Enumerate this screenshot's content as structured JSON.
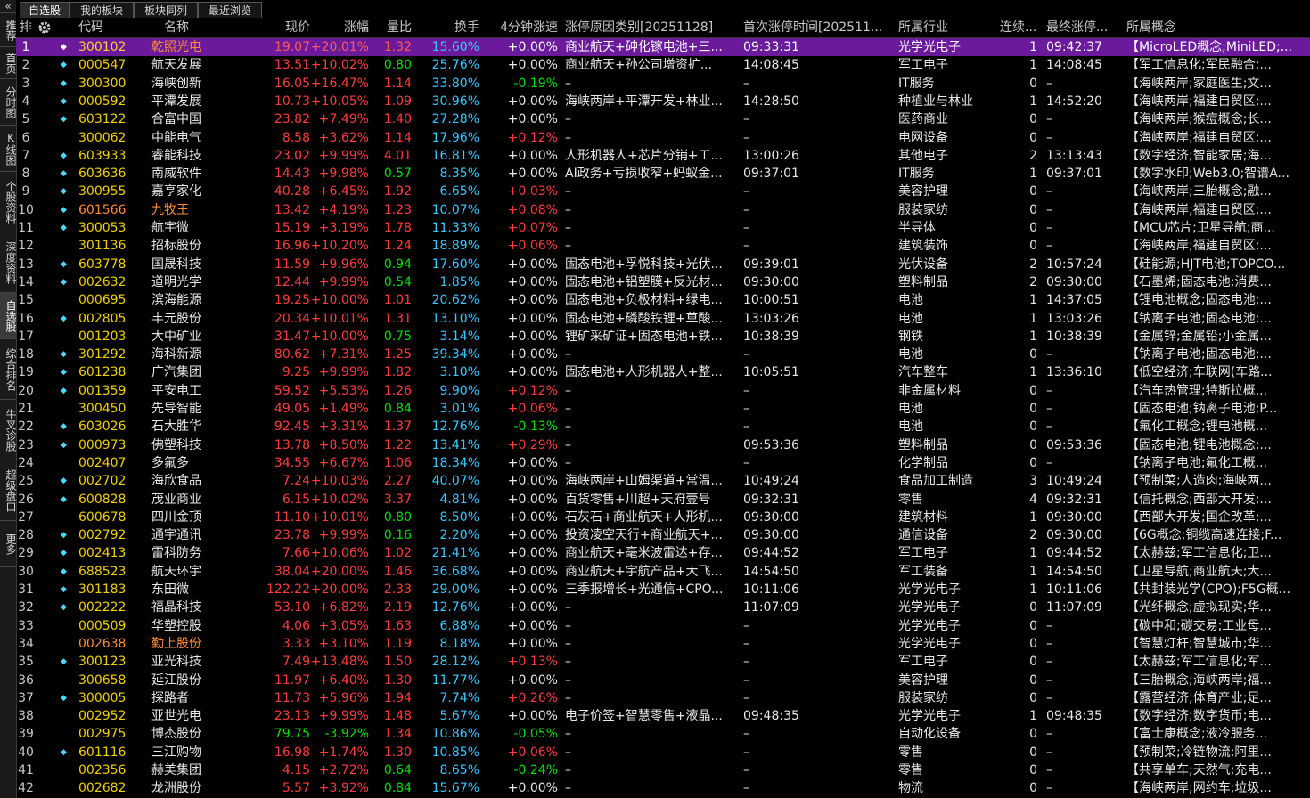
{
  "sidebar": {
    "collapse": "«",
    "items": [
      "推荐",
      "首页",
      "分时图",
      "K线图",
      "个股资料",
      "深度资料",
      "自选股",
      "综合排名",
      "牛叉诊股",
      "超级盘口",
      "更多"
    ]
  },
  "tabs": [
    "自选股",
    "我的板块",
    "板块同列",
    "最近浏览"
  ],
  "header": {
    "rank": "排",
    "settings_icon": "gear-icon",
    "code": "代码",
    "name": "名称",
    "price": "现价",
    "change": "涨幅",
    "vol_ratio": "量比",
    "turnover": "换手",
    "speed": "4分钟涨速",
    "reason": "涨停原因类别[20251128]",
    "first_time": "首次涨停时间[202511...",
    "industry": "所属行业",
    "streak": "连续...",
    "last_time": "最终涨停...",
    "concept": "所属概念"
  },
  "rows": [
    {
      "n": "1",
      "dot": true,
      "code": "300102",
      "name": "乾照光电",
      "price": "19.07",
      "chg": "+20.01%",
      "vr": "1.32",
      "turn": "15.60%",
      "speed": "+0.00%",
      "reason": "商业航天+砷化镓电池+三...",
      "first": "09:33:31",
      "ind": "光学光电子",
      "streak": "1",
      "last": "09:42:37",
      "concept": "【MicroLED概念;MiniLED;..."
    },
    {
      "n": "2",
      "dot": true,
      "code": "000547",
      "name": "航天发展",
      "price": "13.51",
      "chg": "+10.02%",
      "vr": "0.80",
      "turn": "25.76%",
      "speed": "+0.00%",
      "reason": "商业航天+孙公司增资扩...",
      "first": "14:08:45",
      "ind": "军工电子",
      "streak": "1",
      "last": "14:08:45",
      "concept": "【军工信息化;军民融合;..."
    },
    {
      "n": "3",
      "dot": true,
      "code": "300300",
      "name": "海峡创新",
      "price": "16.05",
      "chg": "+16.47%",
      "vr": "1.14",
      "turn": "33.80%",
      "speed": "-0.19%",
      "reason": "–",
      "first": "–",
      "ind": "IT服务",
      "streak": "0",
      "last": "–",
      "concept": "【海峡两岸;家庭医生;文..."
    },
    {
      "n": "4",
      "dot": true,
      "code": "000592",
      "name": "平潭发展",
      "price": "10.73",
      "chg": "+10.05%",
      "vr": "1.09",
      "turn": "30.96%",
      "speed": "+0.00%",
      "reason": "海峡两岸+平潭开发+林业...",
      "first": "14:28:50",
      "ind": "种植业与林业",
      "streak": "1",
      "last": "14:52:20",
      "concept": "【海峡两岸;福建自贸区;..."
    },
    {
      "n": "5",
      "dot": true,
      "code": "603122",
      "name": "合富中国",
      "price": "23.82",
      "chg": "+7.49%",
      "vr": "1.40",
      "turn": "27.28%",
      "speed": "+0.00%",
      "reason": "–",
      "first": "–",
      "ind": "医药商业",
      "streak": "0",
      "last": "–",
      "concept": "【海峡两岸;猴痘概念;长..."
    },
    {
      "n": "6",
      "dot": false,
      "code": "300062",
      "name": "中能电气",
      "price": "8.58",
      "chg": "+3.62%",
      "vr": "1.14",
      "turn": "17.96%",
      "speed": "+0.12%",
      "reason": "–",
      "first": "–",
      "ind": "电网设备",
      "streak": "0",
      "last": "–",
      "concept": "【海峡两岸;福建自贸区;..."
    },
    {
      "n": "7",
      "dot": true,
      "code": "603933",
      "name": "睿能科技",
      "price": "23.02",
      "chg": "+9.99%",
      "vr": "4.01",
      "turn": "16.81%",
      "speed": "+0.00%",
      "reason": "人形机器人+芯片分销+工...",
      "first": "13:00:26",
      "ind": "其他电子",
      "streak": "2",
      "last": "13:13:43",
      "concept": "【数字经济;智能家居;海..."
    },
    {
      "n": "8",
      "dot": true,
      "code": "603636",
      "name": "南威软件",
      "price": "14.43",
      "chg": "+9.98%",
      "vr": "0.57",
      "turn": "8.35%",
      "speed": "+0.00%",
      "reason": "AI政务+亏损收窄+蚂蚁金...",
      "first": "09:37:01",
      "ind": "IT服务",
      "streak": "1",
      "last": "09:37:01",
      "concept": "【数字水印;Web3.0;智谱A..."
    },
    {
      "n": "9",
      "dot": true,
      "code": "300955",
      "name": "嘉亨家化",
      "price": "40.28",
      "chg": "+6.45%",
      "vr": "1.92",
      "turn": "6.65%",
      "speed": "+0.03%",
      "reason": "–",
      "first": "–",
      "ind": "美容护理",
      "streak": "0",
      "last": "–",
      "concept": "【海峡两岸;三胎概念;融..."
    },
    {
      "n": "10",
      "dot": true,
      "code": "601566",
      "name": "九牧王",
      "price": "13.42",
      "chg": "+4.19%",
      "vr": "1.23",
      "turn": "10.07%",
      "speed": "+0.08%",
      "reason": "–",
      "first": "–",
      "ind": "服装家纺",
      "streak": "0",
      "last": "–",
      "concept": "【海峡两岸;福建自贸区;...",
      "orange": true
    },
    {
      "n": "11",
      "dot": true,
      "code": "300053",
      "name": "航宇微",
      "price": "15.19",
      "chg": "+3.19%",
      "vr": "1.78",
      "turn": "11.33%",
      "speed": "+0.07%",
      "reason": "–",
      "first": "–",
      "ind": "半导体",
      "streak": "0",
      "last": "–",
      "concept": "【MCU芯片;卫星导航;商..."
    },
    {
      "n": "12",
      "dot": false,
      "code": "301136",
      "name": "招标股份",
      "price": "16.96",
      "chg": "+10.20%",
      "vr": "1.24",
      "turn": "18.89%",
      "speed": "+0.06%",
      "reason": "–",
      "first": "–",
      "ind": "建筑装饰",
      "streak": "0",
      "last": "–",
      "concept": "【海峡两岸;福建自贸区;..."
    },
    {
      "n": "13",
      "dot": true,
      "code": "603778",
      "name": "国晟科技",
      "price": "11.59",
      "chg": "+9.96%",
      "vr": "0.94",
      "turn": "17.60%",
      "speed": "+0.00%",
      "reason": "固态电池+孚悦科技+光伏...",
      "first": "09:39:01",
      "ind": "光伏设备",
      "streak": "2",
      "last": "10:57:24",
      "concept": "【硅能源;HJT电池;TOPCO..."
    },
    {
      "n": "14",
      "dot": true,
      "code": "002632",
      "name": "道明光学",
      "price": "12.44",
      "chg": "+9.99%",
      "vr": "0.54",
      "turn": "1.85%",
      "speed": "+0.00%",
      "reason": "固态电池+铝塑膜+反光材...",
      "first": "09:30:00",
      "ind": "塑料制品",
      "streak": "2",
      "last": "09:30:00",
      "concept": "【石墨烯;固态电池;消费..."
    },
    {
      "n": "15",
      "dot": false,
      "code": "000695",
      "name": "滨海能源",
      "price": "19.25",
      "chg": "+10.00%",
      "vr": "1.01",
      "turn": "20.62%",
      "speed": "+0.00%",
      "reason": "固态电池+负极材料+绿电...",
      "first": "10:00:51",
      "ind": "电池",
      "streak": "1",
      "last": "14:37:05",
      "concept": "【锂电池概念;固态电池;..."
    },
    {
      "n": "16",
      "dot": true,
      "code": "002805",
      "name": "丰元股份",
      "price": "20.34",
      "chg": "+10.01%",
      "vr": "1.31",
      "turn": "13.10%",
      "speed": "+0.00%",
      "reason": "固态电池+磷酸铁锂+草酸...",
      "first": "13:03:26",
      "ind": "电池",
      "streak": "1",
      "last": "13:03:26",
      "concept": "【钠离子电池;固态电池;..."
    },
    {
      "n": "17",
      "dot": false,
      "code": "001203",
      "name": "大中矿业",
      "price": "31.47",
      "chg": "+10.00%",
      "vr": "0.75",
      "turn": "3.14%",
      "speed": "+0.00%",
      "reason": "锂矿采矿证+固态电池+铁...",
      "first": "10:38:39",
      "ind": "钢铁",
      "streak": "1",
      "last": "10:38:39",
      "concept": "【金属锌;金属铅;小金属..."
    },
    {
      "n": "18",
      "dot": true,
      "code": "301292",
      "name": "海科新源",
      "price": "80.62",
      "chg": "+7.31%",
      "vr": "1.25",
      "turn": "39.34%",
      "speed": "+0.00%",
      "reason": "–",
      "first": "–",
      "ind": "电池",
      "streak": "0",
      "last": "–",
      "concept": "【钠离子电池;固态电池;..."
    },
    {
      "n": "19",
      "dot": true,
      "code": "601238",
      "name": "广汽集团",
      "price": "9.25",
      "chg": "+9.99%",
      "vr": "1.82",
      "turn": "3.10%",
      "speed": "+0.00%",
      "reason": "固态电池+人形机器人+整...",
      "first": "10:05:51",
      "ind": "汽车整车",
      "streak": "1",
      "last": "13:36:10",
      "concept": "【低空经济;车联网(车路..."
    },
    {
      "n": "20",
      "dot": true,
      "code": "001359",
      "name": "平安电工",
      "price": "59.52",
      "chg": "+5.53%",
      "vr": "1.26",
      "turn": "9.90%",
      "speed": "+0.12%",
      "reason": "–",
      "first": "–",
      "ind": "非金属材料",
      "streak": "0",
      "last": "–",
      "concept": "【汽车热管理;特斯拉概..."
    },
    {
      "n": "21",
      "dot": false,
      "code": "300450",
      "name": "先导智能",
      "price": "49.05",
      "chg": "+1.49%",
      "vr": "0.84",
      "turn": "3.01%",
      "speed": "+0.06%",
      "reason": "–",
      "first": "–",
      "ind": "电池",
      "streak": "0",
      "last": "–",
      "concept": "【固态电池;钠离子电池;P..."
    },
    {
      "n": "22",
      "dot": true,
      "code": "603026",
      "name": "石大胜华",
      "price": "92.45",
      "chg": "+3.31%",
      "vr": "1.37",
      "turn": "12.76%",
      "speed": "-0.13%",
      "reason": "–",
      "first": "–",
      "ind": "电池",
      "streak": "0",
      "last": "–",
      "concept": "【氟化工概念;锂电池概..."
    },
    {
      "n": "23",
      "dot": true,
      "code": "000973",
      "name": "佛塑科技",
      "price": "13.78",
      "chg": "+8.50%",
      "vr": "1.22",
      "turn": "13.41%",
      "speed": "+0.29%",
      "reason": "–",
      "first": "09:53:36",
      "ind": "塑料制品",
      "streak": "0",
      "last": "09:53:36",
      "concept": "【固态电池;锂电池概念;..."
    },
    {
      "n": "24",
      "dot": false,
      "code": "002407",
      "name": "多氟多",
      "price": "34.55",
      "chg": "+6.67%",
      "vr": "1.06",
      "turn": "18.34%",
      "speed": "+0.00%",
      "reason": "–",
      "first": "–",
      "ind": "化学制品",
      "streak": "0",
      "last": "–",
      "concept": "【钠离子电池;氟化工概..."
    },
    {
      "n": "25",
      "dot": true,
      "code": "002702",
      "name": "海欣食品",
      "price": "7.24",
      "chg": "+10.03%",
      "vr": "2.27",
      "turn": "40.07%",
      "speed": "+0.00%",
      "reason": "海峡两岸+山姆渠道+常温...",
      "first": "10:49:24",
      "ind": "食品加工制造",
      "streak": "3",
      "last": "10:49:24",
      "concept": "【预制菜;人造肉;海峡两..."
    },
    {
      "n": "26",
      "dot": true,
      "code": "600828",
      "name": "茂业商业",
      "price": "6.15",
      "chg": "+10.02%",
      "vr": "3.37",
      "turn": "4.81%",
      "speed": "+0.00%",
      "reason": "百货零售+川超+天府壹号",
      "first": "09:32:31",
      "ind": "零售",
      "streak": "4",
      "last": "09:32:31",
      "concept": "【信托概念;西部大开发;..."
    },
    {
      "n": "27",
      "dot": false,
      "code": "600678",
      "name": "四川金顶",
      "price": "11.10",
      "chg": "+10.01%",
      "vr": "0.80",
      "turn": "8.50%",
      "speed": "+0.00%",
      "reason": "石灰石+商业航天+人形机...",
      "first": "09:30:00",
      "ind": "建筑材料",
      "streak": "1",
      "last": "09:30:00",
      "concept": "【西部大开发;国企改革;..."
    },
    {
      "n": "28",
      "dot": true,
      "code": "002792",
      "name": "通宇通讯",
      "price": "23.78",
      "chg": "+9.99%",
      "vr": "0.16",
      "turn": "2.20%",
      "speed": "+0.00%",
      "reason": "投资凌空天行+商业航天+...",
      "first": "09:30:00",
      "ind": "通信设备",
      "streak": "2",
      "last": "09:30:00",
      "concept": "【6G概念;铜缆高速连接;F..."
    },
    {
      "n": "29",
      "dot": true,
      "code": "002413",
      "name": "雷科防务",
      "price": "7.66",
      "chg": "+10.06%",
      "vr": "1.02",
      "turn": "21.41%",
      "speed": "+0.00%",
      "reason": "商业航天+毫米波雷达+存...",
      "first": "09:44:52",
      "ind": "军工电子",
      "streak": "1",
      "last": "09:44:52",
      "concept": "【太赫兹;军工信息化;卫..."
    },
    {
      "n": "30",
      "dot": true,
      "code": "688523",
      "name": "航天环宇",
      "price": "38.04",
      "chg": "+20.00%",
      "vr": "1.46",
      "turn": "36.68%",
      "speed": "+0.00%",
      "reason": "商业航天+宇航产品+大飞...",
      "first": "14:54:50",
      "ind": "军工装备",
      "streak": "1",
      "last": "14:54:50",
      "concept": "【卫星导航;商业航天;大..."
    },
    {
      "n": "31",
      "dot": true,
      "code": "301183",
      "name": "东田微",
      "price": "122.22",
      "chg": "+20.00%",
      "vr": "2.33",
      "turn": "29.00%",
      "speed": "+0.00%",
      "reason": "三季报增长+光通信+CPO...",
      "first": "10:11:06",
      "ind": "光学光电子",
      "streak": "1",
      "last": "10:11:06",
      "concept": "【共封装光学(CPO);F5G概..."
    },
    {
      "n": "32",
      "dot": true,
      "code": "002222",
      "name": "福晶科技",
      "price": "53.10",
      "chg": "+6.82%",
      "vr": "2.19",
      "turn": "12.76%",
      "speed": "+0.00%",
      "reason": "–",
      "first": "11:07:09",
      "ind": "光学光电子",
      "streak": "0",
      "last": "11:07:09",
      "concept": "【光纤概念;虚拟现实;华..."
    },
    {
      "n": "33",
      "dot": false,
      "code": "000509",
      "name": "华塑控股",
      "price": "4.06",
      "chg": "+3.05%",
      "vr": "1.63",
      "turn": "6.88%",
      "speed": "+0.00%",
      "reason": "–",
      "first": "–",
      "ind": "光学光电子",
      "streak": "0",
      "last": "–",
      "concept": "【碳中和;碳交易;工业母..."
    },
    {
      "n": "34",
      "dot": false,
      "code": "002638",
      "name": "勤上股份",
      "price": "3.33",
      "chg": "+3.10%",
      "vr": "1.19",
      "turn": "8.18%",
      "speed": "+0.00%",
      "reason": "–",
      "first": "–",
      "ind": "光学光电子",
      "streak": "0",
      "last": "–",
      "concept": "【智慧灯杆;智慧城市;华...",
      "orange": true
    },
    {
      "n": "35",
      "dot": true,
      "code": "300123",
      "name": "亚光科技",
      "price": "7.49",
      "chg": "+13.48%",
      "vr": "1.50",
      "turn": "28.12%",
      "speed": "+0.13%",
      "reason": "–",
      "first": "–",
      "ind": "军工电子",
      "streak": "0",
      "last": "–",
      "concept": "【太赫兹;军工信息化;军..."
    },
    {
      "n": "36",
      "dot": false,
      "code": "300658",
      "name": "延江股份",
      "price": "11.97",
      "chg": "+6.40%",
      "vr": "1.30",
      "turn": "11.77%",
      "speed": "+0.00%",
      "reason": "–",
      "first": "–",
      "ind": "美容护理",
      "streak": "0",
      "last": "–",
      "concept": "【三胎概念;海峡两岸;福..."
    },
    {
      "n": "37",
      "dot": true,
      "code": "300005",
      "name": "探路者",
      "price": "11.73",
      "chg": "+5.96%",
      "vr": "1.94",
      "turn": "7.74%",
      "speed": "+0.26%",
      "reason": "–",
      "first": "–",
      "ind": "服装家纺",
      "streak": "0",
      "last": "–",
      "concept": "【露营经济;体育产业;足..."
    },
    {
      "n": "38",
      "dot": false,
      "code": "002952",
      "name": "亚世光电",
      "price": "23.13",
      "chg": "+9.99%",
      "vr": "1.48",
      "turn": "5.67%",
      "speed": "+0.00%",
      "reason": "电子价签+智慧零售+液晶...",
      "first": "09:48:35",
      "ind": "光学光电子",
      "streak": "1",
      "last": "09:48:35",
      "concept": "【数字经济;数字货币;电..."
    },
    {
      "n": "39",
      "dot": false,
      "code": "002975",
      "name": "博杰股份",
      "price": "79.75",
      "chg": "-3.92%",
      "vr": "1.34",
      "turn": "10.86%",
      "speed": "-0.05%",
      "reason": "–",
      "first": "–",
      "ind": "自动化设备",
      "streak": "0",
      "last": "–",
      "concept": "【富士康概念;液冷服务..."
    },
    {
      "n": "40",
      "dot": true,
      "code": "601116",
      "name": "三江购物",
      "price": "16.98",
      "chg": "+1.74%",
      "vr": "1.30",
      "turn": "10.85%",
      "speed": "+0.06%",
      "reason": "–",
      "first": "–",
      "ind": "零售",
      "streak": "0",
      "last": "–",
      "concept": "【预制菜;冷链物流;阿里..."
    },
    {
      "n": "41",
      "dot": false,
      "code": "002356",
      "name": "赫美集团",
      "price": "4.15",
      "chg": "+2.72%",
      "vr": "0.64",
      "turn": "8.65%",
      "speed": "-0.24%",
      "reason": "–",
      "first": "–",
      "ind": "零售",
      "streak": "0",
      "last": "–",
      "concept": "【共享单车;天然气;充电..."
    },
    {
      "n": "42",
      "dot": false,
      "code": "002682",
      "name": "龙洲股份",
      "price": "5.57",
      "chg": "+3.92%",
      "vr": "0.84",
      "turn": "15.67%",
      "speed": "+0.00%",
      "reason": "–",
      "first": "–",
      "ind": "物流",
      "streak": "0",
      "last": "–",
      "concept": "【海峡两岸;网约车;垃圾..."
    }
  ],
  "selected_row_index": 0,
  "colors": {
    "up": "#ff3b3b",
    "down": "#00e000",
    "turnover": "#38c8ff",
    "code": "#f0d000",
    "selected": "#6a1a9a"
  }
}
